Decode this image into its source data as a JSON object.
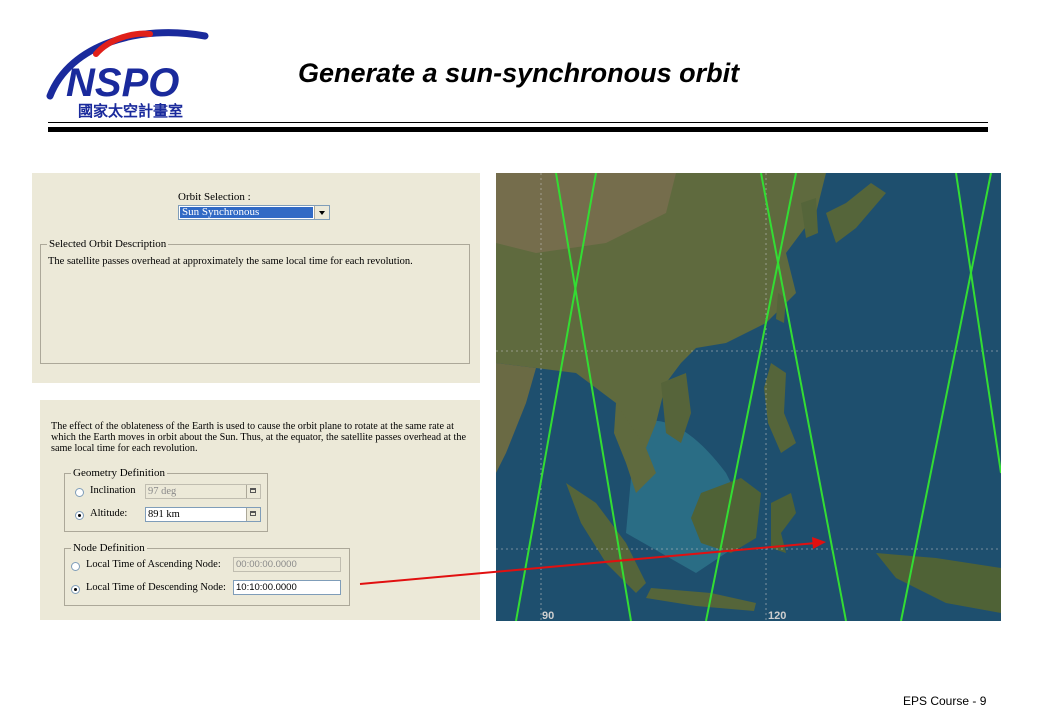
{
  "slide": {
    "title": "Generate a sun-synchronous orbit",
    "footer": "EPS Course - 9"
  },
  "logo": {
    "text": "NSPO",
    "subtitle": "國家太空計畫室",
    "colors": {
      "primary": "#1a2a9c",
      "accent": "#e0201a"
    }
  },
  "orbit_selection": {
    "label": "Orbit Selection :",
    "selected": "Sun Synchronous"
  },
  "description": {
    "legend": "Selected Orbit Description",
    "text": "The satellite passes overhead at approximately the same local time for each revolution."
  },
  "effect_text": "The effect of the oblateness of the Earth is used to cause the orbit plane to rotate at the same rate at which the Earth moves in orbit about the Sun.  Thus, at the equator, the satellite passes overhead at the same local time for each revolution.",
  "geometry": {
    "legend": "Geometry Definition",
    "inclination": {
      "label": "Inclination",
      "value": "97 deg",
      "selected": false
    },
    "altitude": {
      "label": "Altitude:",
      "value": "891 km",
      "selected": true
    }
  },
  "node": {
    "legend": "Node Definition",
    "ascending": {
      "label": "Local Time of Ascending Node:",
      "value": "00:00:00.0000",
      "selected": false
    },
    "descending": {
      "label": "Local Time of Descending Node:",
      "value": "10:10:00.0000",
      "selected": true
    }
  },
  "map": {
    "lon_labels": [
      "90",
      "120"
    ],
    "colors": {
      "ground_track": "#33dd33",
      "ocean": "#1e4f6e",
      "land": "#5f6a3e",
      "pointer": "#e11010"
    }
  }
}
